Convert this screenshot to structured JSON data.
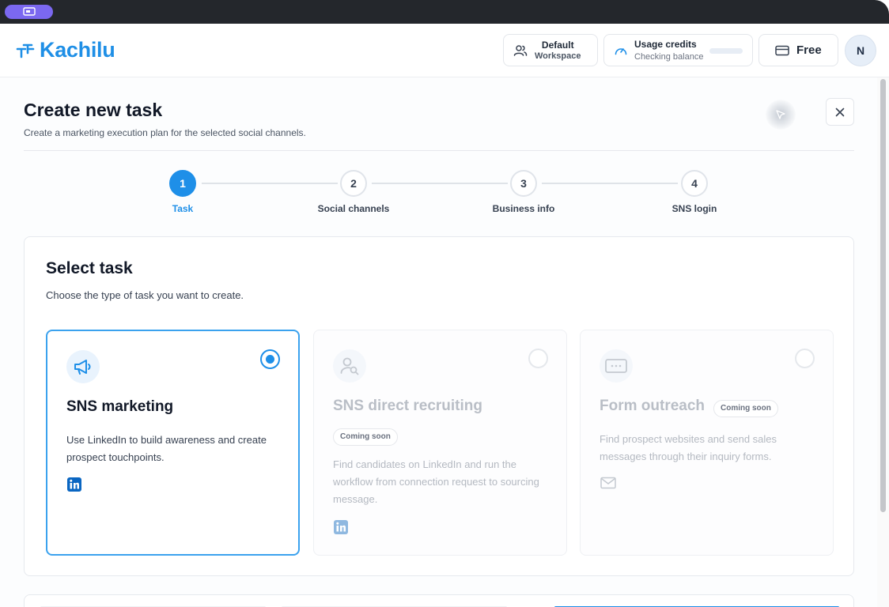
{
  "app": {
    "name": "Kachilu"
  },
  "header": {
    "workspace": {
      "line1": "Default",
      "line2": "Workspace"
    },
    "credits": {
      "title": "Usage credits",
      "status": "Checking balance"
    },
    "plan": {
      "label": "Free"
    },
    "avatar": {
      "initial": "N"
    }
  },
  "page": {
    "title": "Create new task",
    "subtitle": "Create a marketing execution plan for the selected social channels."
  },
  "stepper": {
    "steps": [
      {
        "number": "1",
        "label": "Task",
        "active": true
      },
      {
        "number": "2",
        "label": "Social channels",
        "active": false
      },
      {
        "number": "3",
        "label": "Business info",
        "active": false
      },
      {
        "number": "4",
        "label": "SNS login",
        "active": false
      }
    ]
  },
  "panel": {
    "title": "Select task",
    "subtitle": "Choose the type of task you want to create.",
    "cards": [
      {
        "title": "SNS marketing",
        "description": "Use LinkedIn to build awareness and create prospect touchpoints.",
        "icon": "megaphone-icon",
        "footer_icon": "linkedin-icon",
        "selected": true,
        "badge": ""
      },
      {
        "title": "SNS direct recruiting",
        "description": "Find candidates on LinkedIn and run the workflow from connection request to sourcing message.",
        "icon": "user-search-icon",
        "footer_icon": "linkedin-icon",
        "selected": false,
        "badge": "Coming soon"
      },
      {
        "title": "Form outreach",
        "description": "Find prospect websites and send sales messages through their inquiry forms.",
        "icon": "form-icon",
        "footer_icon": "mail-icon",
        "selected": false,
        "badge": "Coming soon"
      }
    ]
  },
  "colors": {
    "accent": "#1e8fe8",
    "brand": "#1f8fe6",
    "os_pill": "#7b68f0"
  }
}
